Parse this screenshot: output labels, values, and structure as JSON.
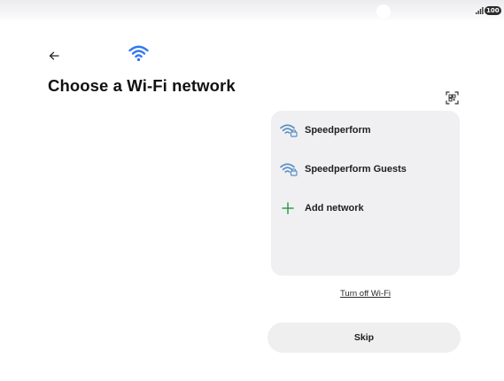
{
  "status_bar": {
    "battery_level": "100",
    "signal_icon": "signal-bars-icon",
    "colors": {
      "battery_badge": "#2b2b2b"
    }
  },
  "header": {
    "back_icon": "arrow-left-icon",
    "wifi_icon": "wifi-icon",
    "title": "Choose a Wi-Fi network",
    "qr_icon": "qr-scan-icon"
  },
  "networks": [
    {
      "name": "Speedperform",
      "icon": "wifi-lock-icon",
      "secured": true
    },
    {
      "name": "Speedperform Guests",
      "icon": "wifi-lock-icon",
      "secured": true
    }
  ],
  "add_network": {
    "label": "Add network",
    "icon": "plus-icon"
  },
  "turn_off_wifi_label": "Turn off Wi-Fi",
  "skip_label": "Skip",
  "colors": {
    "accent_blue": "#2f78f0",
    "network_icon": "#5a8fc7",
    "add_icon": "#2e9e4f",
    "card_background": "#f0f0f2"
  }
}
